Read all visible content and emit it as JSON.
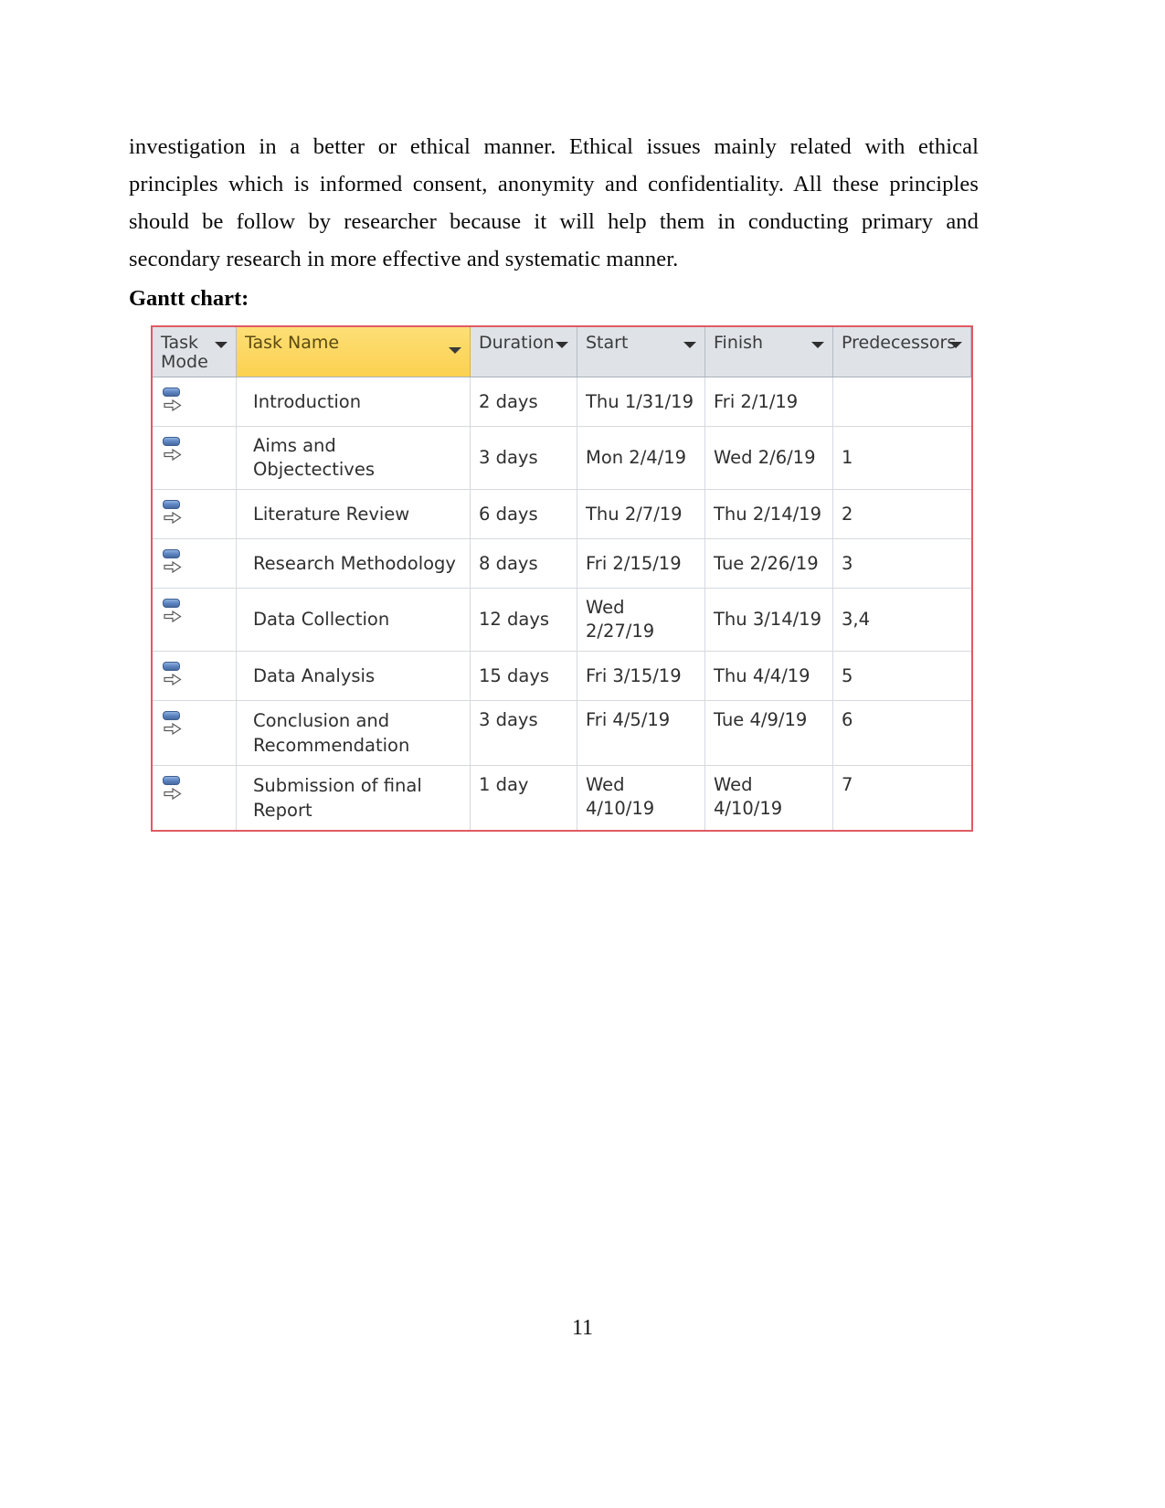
{
  "document": {
    "paragraph": "investigation in a better or ethical manner. Ethical issues mainly related with ethical principles which is informed consent, anonymity and confidentiality. All these principles should be follow by researcher because it will help them in conducting primary and secondary research in more effective and systematic manner.",
    "heading": "Gantt chart:",
    "page_number": "11"
  },
  "gantt_table": {
    "accent_border_color": "#e05a63",
    "highlight_column_color": "#fcd964",
    "header_background_color": "#dfe3e8",
    "columns": [
      {
        "key": "task_mode",
        "label": "Task\nMode",
        "filter": true,
        "highlighted": false
      },
      {
        "key": "task_name",
        "label": "Task Name",
        "filter": true,
        "highlighted": true
      },
      {
        "key": "duration",
        "label": "Duration",
        "filter": true,
        "highlighted": false
      },
      {
        "key": "start",
        "label": "Start",
        "filter": true,
        "highlighted": false
      },
      {
        "key": "finish",
        "label": "Finish",
        "filter": true,
        "highlighted": false
      },
      {
        "key": "predecessors",
        "label": "Predecessors",
        "filter": true,
        "highlighted": false
      }
    ],
    "rows": [
      {
        "mode_icon": "auto-scheduled-icon",
        "task_name": "Introduction",
        "duration": "2 days",
        "start": "Thu 1/31/19",
        "finish": "Fri 2/1/19",
        "predecessors": ""
      },
      {
        "mode_icon": "auto-scheduled-icon",
        "task_name": "Aims and Objectectives",
        "duration": "3 days",
        "start": "Mon 2/4/19",
        "finish": "Wed 2/6/19",
        "predecessors": "1"
      },
      {
        "mode_icon": "auto-scheduled-icon",
        "task_name": "Literature Review",
        "duration": "6 days",
        "start": "Thu 2/7/19",
        "finish": "Thu 2/14/19",
        "predecessors": "2"
      },
      {
        "mode_icon": "auto-scheduled-icon",
        "task_name": "Research Methodology",
        "duration": "8 days",
        "start": "Fri 2/15/19",
        "finish": "Tue 2/26/19",
        "predecessors": "3"
      },
      {
        "mode_icon": "auto-scheduled-icon",
        "task_name": "Data Collection",
        "duration": "12 days",
        "start": "Wed 2/27/19",
        "finish": "Thu 3/14/19",
        "predecessors": "3,4"
      },
      {
        "mode_icon": "auto-scheduled-icon",
        "task_name": "Data Analysis",
        "duration": "15 days",
        "start": "Fri 3/15/19",
        "finish": "Thu 4/4/19",
        "predecessors": "5"
      },
      {
        "mode_icon": "auto-scheduled-icon",
        "task_name": "Conclusion and Recommendation",
        "duration": "3 days",
        "start": "Fri 4/5/19",
        "finish": "Tue 4/9/19",
        "predecessors": "6"
      },
      {
        "mode_icon": "auto-scheduled-icon",
        "task_name": "Submission of final Report",
        "duration": "1 day",
        "start": "Wed 4/10/19",
        "finish": "Wed 4/10/19",
        "predecessors": "7"
      }
    ]
  }
}
